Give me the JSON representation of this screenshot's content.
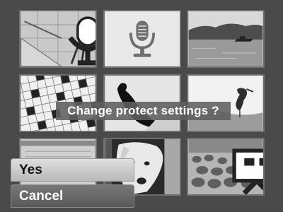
{
  "prompt": "Change protect settings ?",
  "options": [
    {
      "label": "Yes",
      "selected": true
    },
    {
      "label": "Cancel",
      "selected": false
    }
  ],
  "thumbnails": [
    {
      "subject": "drafting tools",
      "badge": "voice-memo-icon"
    },
    {
      "subject": "voice memo file",
      "badge": "microphone-icon"
    },
    {
      "subject": "lake with boat",
      "badge": ""
    },
    {
      "subject": "crossword puzzle",
      "badge": ""
    },
    {
      "subject": "bird silhouette",
      "badge": ""
    },
    {
      "subject": "heron on shore",
      "badge": ""
    },
    {
      "subject": "document",
      "badge": ""
    },
    {
      "subject": "dog face",
      "badge": ""
    },
    {
      "subject": "flock of sheep",
      "badge": "movie-icon"
    }
  ],
  "colors": {
    "highlight": "#dedede",
    "dialog": "#5f5f5f",
    "background": "#4a4a4a"
  }
}
